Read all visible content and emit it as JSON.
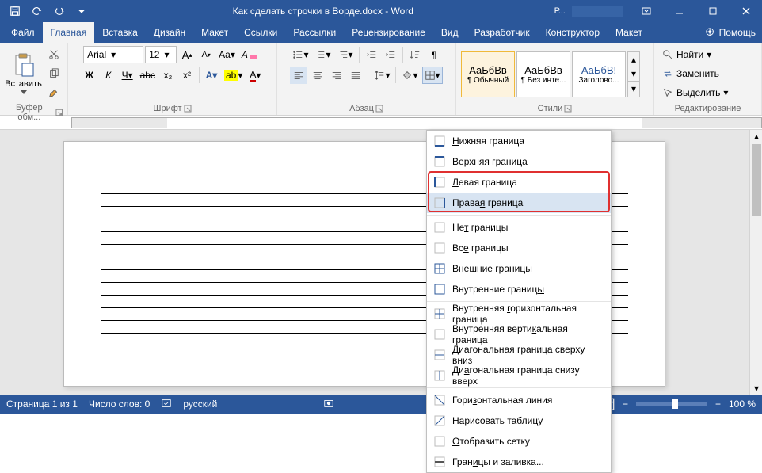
{
  "title": "Как сделать строчки в Ворде.docx - Word",
  "account_hint": "Р...",
  "tabs": {
    "file": "Файл",
    "items": [
      "Главная",
      "Вставка",
      "Дизайн",
      "Макет",
      "Ссылки",
      "Рассылки",
      "Рецензирование",
      "Вид",
      "Разработчик",
      "Конструктор",
      "Макет"
    ],
    "active_index": 0,
    "tell_me": "Помощь",
    "share": "⤴"
  },
  "ribbon": {
    "clipboard": {
      "paste": "Вставить",
      "label": "Буфер обм..."
    },
    "font": {
      "name": "Arial",
      "size": "12",
      "label": "Шрифт",
      "bold": "Ж",
      "italic": "К",
      "underline": "Ч",
      "strike": "abc",
      "sub": "x₂",
      "sup": "x²",
      "caps": "Aa",
      "clear": "⌫"
    },
    "paragraph": {
      "label": "Абзац"
    },
    "styles": {
      "label": "Стили",
      "items": [
        {
          "sample": "АаБбВв",
          "name": "¶ Обычный"
        },
        {
          "sample": "АаБбВв",
          "name": "¶ Без инте..."
        },
        {
          "sample": "АаБбВ!",
          "name": "Заголово..."
        }
      ]
    },
    "editing": {
      "find": "Найти",
      "replace": "Заменить",
      "select": "Выделить",
      "label": "Редактирование"
    }
  },
  "borders_menu": {
    "items": [
      {
        "label": "Нижняя граница",
        "accel": "Н"
      },
      {
        "label": "Верхняя граница",
        "accel": "В"
      },
      {
        "label": "Левая граница",
        "accel": "Л",
        "hl": true
      },
      {
        "label": "Правая граница",
        "accel": "я",
        "hl": true,
        "hover": true
      },
      {
        "sep": true
      },
      {
        "label": "Нет границы",
        "accel": "т"
      },
      {
        "label": "Все границы",
        "accel": "е"
      },
      {
        "label": "Внешние границы",
        "accel": "ш"
      },
      {
        "label": "Внутренние границы",
        "accel": "ы"
      },
      {
        "sep": true
      },
      {
        "label": "Внутренняя горизонтальная граница",
        "accel": "г"
      },
      {
        "label": "Внутренняя вертикальная граница",
        "accel": "к"
      },
      {
        "label": "Диагональная граница сверху вниз",
        "accel": "Д"
      },
      {
        "label": "Диагональная граница снизу вверх",
        "accel": "а"
      },
      {
        "sep": true
      },
      {
        "label": "Горизонтальная линия",
        "accel": "з"
      },
      {
        "label": "Нарисовать таблицу",
        "accel": "Н"
      },
      {
        "label": "Отобразить сетку",
        "accel": "О"
      },
      {
        "label": "Границы и заливка...",
        "accel": "и"
      }
    ]
  },
  "status": {
    "page": "Страница 1 из 1",
    "words": "Число слов: 0",
    "lang": "русский",
    "zoom": "100 %"
  },
  "doc": {
    "line_count": 12
  }
}
